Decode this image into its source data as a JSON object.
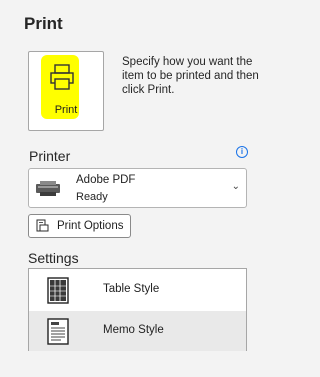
{
  "header": {
    "title": "Print"
  },
  "print_button": {
    "label": "Print",
    "icon": "printer-icon",
    "highlight_color": "#ffff00"
  },
  "description": "Specify how you want the item to be printed and then click Print.",
  "printer": {
    "section_label": "Printer",
    "info_icon": "info-icon",
    "selected_name": "Adobe PDF",
    "status": "Ready",
    "options_button_label": "Print Options"
  },
  "settings": {
    "section_label": "Settings",
    "styles": [
      {
        "label": "Table Style",
        "icon": "table-style-icon",
        "selected": false
      },
      {
        "label": "Memo Style",
        "icon": "memo-style-icon",
        "selected": true
      }
    ]
  }
}
